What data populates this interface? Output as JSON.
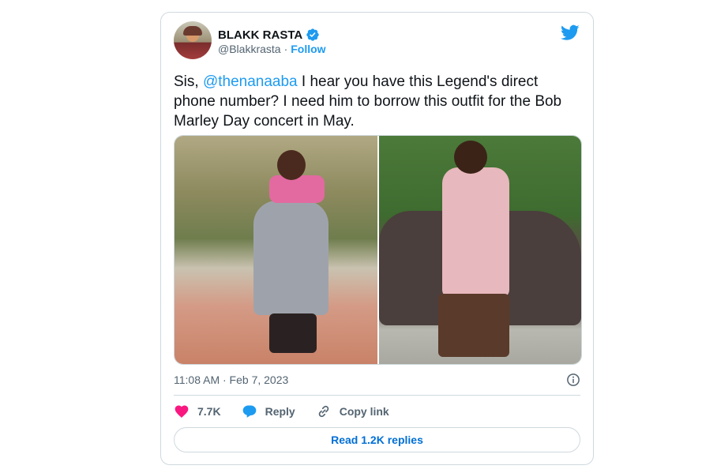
{
  "tweet": {
    "author": {
      "name": "BLAKK RASTA",
      "handle": "@Blakkrasta",
      "separator": "·",
      "follow_label": "Follow"
    },
    "text_prefix": "Sis, ",
    "mention": "@thenanaaba",
    "text_suffix": " I hear you have this Legend's direct phone number? I need him to borrow this outfit for the Bob Marley Day concert in May.",
    "timestamp": "11:08 AM · Feb 7, 2023",
    "likes": "7.7K",
    "reply_label": "Reply",
    "copy_link_label": "Copy link",
    "read_replies_label": "Read 1.2K replies"
  },
  "colors": {
    "brand_blue": "#1d9bf0",
    "like_pink": "#f91880",
    "link_blue": "#006fd6",
    "muted_text": "#536471"
  },
  "icons": [
    "verified-badge-icon",
    "twitter-bird-icon",
    "info-icon",
    "heart-icon",
    "reply-bubble-icon",
    "link-icon"
  ]
}
